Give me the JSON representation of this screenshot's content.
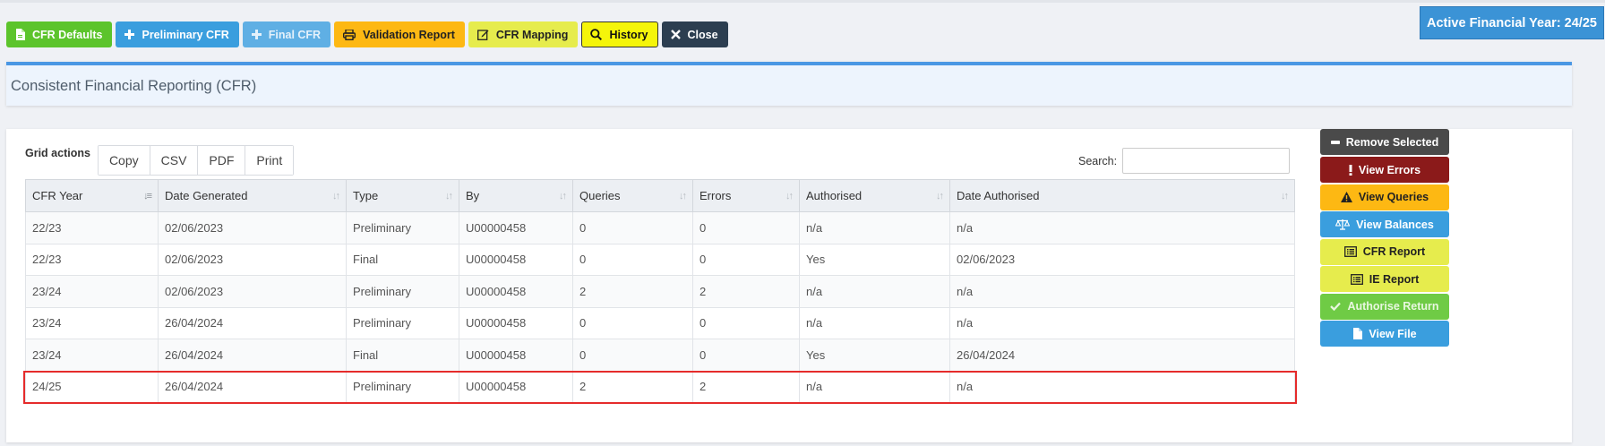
{
  "toolbar": {
    "buttons": [
      {
        "label": "CFR Defaults",
        "icon": "file-icon",
        "color": "#5cc42c"
      },
      {
        "label": "Preliminary CFR",
        "icon": "plus-icon",
        "color": "#3a9ede"
      },
      {
        "label": "Final CFR",
        "icon": "plus-icon",
        "color": "#5fafe4",
        "disabled": true
      },
      {
        "label": "Validation Report",
        "icon": "print-icon",
        "color": "#fdb813"
      },
      {
        "label": "CFR Mapping",
        "icon": "edit-icon",
        "color": "#e6ec4d"
      },
      {
        "label": "History",
        "icon": "search-icon",
        "color": "#f5f50a"
      },
      {
        "label": "Close",
        "icon": "close-icon",
        "color": "#2c3e50"
      }
    ]
  },
  "financial_year_badge": "Active Financial Year: 24/25",
  "page_title": "Consistent Financial Reporting (CFR)",
  "grid": {
    "actions_label": "Grid actions",
    "action_buttons": [
      "Copy",
      "CSV",
      "PDF",
      "Print"
    ],
    "search_label": "Search:",
    "search_value": "",
    "columns": [
      "CFR Year",
      "Date Generated",
      "Type",
      "By",
      "Queries",
      "Errors",
      "Authorised",
      "Date Authorised"
    ],
    "sorted_column": "CFR Year",
    "rows": [
      [
        "22/23",
        "02/06/2023",
        "Preliminary",
        "U00000458",
        "0",
        "0",
        "n/a",
        "n/a"
      ],
      [
        "22/23",
        "02/06/2023",
        "Final",
        "U00000458",
        "0",
        "0",
        "Yes",
        "02/06/2023"
      ],
      [
        "23/24",
        "02/06/2023",
        "Preliminary",
        "U00000458",
        "2",
        "2",
        "n/a",
        "n/a"
      ],
      [
        "23/24",
        "26/04/2024",
        "Preliminary",
        "U00000458",
        "0",
        "0",
        "n/a",
        "n/a"
      ],
      [
        "23/24",
        "26/04/2024",
        "Final",
        "U00000458",
        "0",
        "0",
        "Yes",
        "26/04/2024"
      ],
      [
        "24/25",
        "26/04/2024",
        "Preliminary",
        "U00000458",
        "2",
        "2",
        "n/a",
        "n/a"
      ]
    ],
    "highlighted_row": 5,
    "highlight_color": "#e52b2b"
  },
  "side_actions": [
    {
      "label": "Remove Selected",
      "icon": "minus-icon",
      "color": "#4a4a4a"
    },
    {
      "label": "View Errors",
      "icon": "exclamation-icon",
      "color": "#8b1a1a"
    },
    {
      "label": "View Queries",
      "icon": "warning-icon",
      "color": "#fdb813"
    },
    {
      "label": "View Balances",
      "icon": "balance-scale-icon",
      "color": "#3a9ede"
    },
    {
      "label": "CFR Report",
      "icon": "list-icon",
      "color": "#e6ec4d"
    },
    {
      "label": "IE Report",
      "icon": "list-icon",
      "color": "#e6ec4d"
    },
    {
      "label": "Authorise Return",
      "icon": "check-icon",
      "color": "#6fcb45",
      "disabled": true
    },
    {
      "label": "View File",
      "icon": "file-icon",
      "color": "#3a9ede"
    }
  ]
}
